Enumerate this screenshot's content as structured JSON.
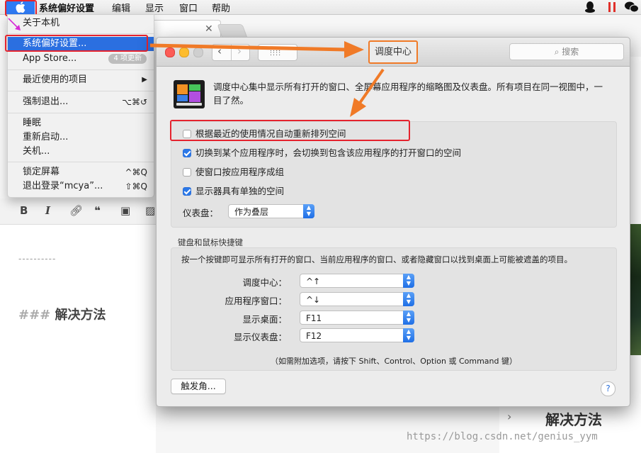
{
  "menubar": {
    "items": [
      "系统偏好设置",
      "编辑",
      "显示",
      "窗口",
      "帮助"
    ]
  },
  "apple_menu": {
    "about": "关于本机",
    "sysprefs": "系统偏好设置...",
    "appstore": "App Store...",
    "appstore_badge": "4 项更新",
    "recent": "最近使用的项目",
    "force_quit": "强制退出...",
    "force_quit_shortcut": "⌥⌘↺",
    "sleep": "睡眠",
    "restart": "重新启动...",
    "shutdown": "关机...",
    "lock": "锁定屏幕",
    "lock_shortcut": "^⌘Q",
    "logout": "退出登录“mcya”...",
    "logout_shortcut": "⇧⌘Q"
  },
  "editor": {
    "dashes": "----------",
    "heading_hash": "###",
    "heading_text": "解决方法",
    "right_heading": "解决方法",
    "watermark": "https://blog.csdn.net/genius_yym"
  },
  "prefs": {
    "title": "调度中心",
    "search_placeholder": "搜索",
    "description": "调度中心集中显示所有打开的窗口、全屏幕应用程序的缩略图及仪表盘。所有项目在同一视图中，一目了然。",
    "options": [
      {
        "label": "根据最近的使用情况自动重新排列空间",
        "checked": false
      },
      {
        "label": "切换到某个应用程序时，会切换到包含该应用程序的打开窗口的空间",
        "checked": true
      },
      {
        "label": "使窗口按应用程序成组",
        "checked": false
      },
      {
        "label": "显示器具有单独的空间",
        "checked": true
      }
    ],
    "dashboard_label": "仪表盘：",
    "dashboard_value": "作为叠层",
    "shortcuts_heading": "键盘和鼠标快捷键",
    "shortcuts_desc": "按一个按键即可显示所有打开的窗口、当前应用程序的窗口、或者隐藏窗口以找到桌面上可能被遮盖的项目。",
    "shortcuts": [
      {
        "label": "调度中心：",
        "value": "^↑"
      },
      {
        "label": "应用程序窗口：",
        "value": "^↓"
      },
      {
        "label": "显示桌面：",
        "value": "F11"
      },
      {
        "label": "显示仪表盘：",
        "value": "F12"
      }
    ],
    "hint": "（如需附加选项，请按下 Shift、Control、Option 或 Command 键）",
    "hot_corners": "触发角...",
    "help": "?"
  },
  "colors": {
    "highlight": "#2b6fe0",
    "annotation_red": "#e5232e",
    "annotation_orange": "#f07a27"
  }
}
